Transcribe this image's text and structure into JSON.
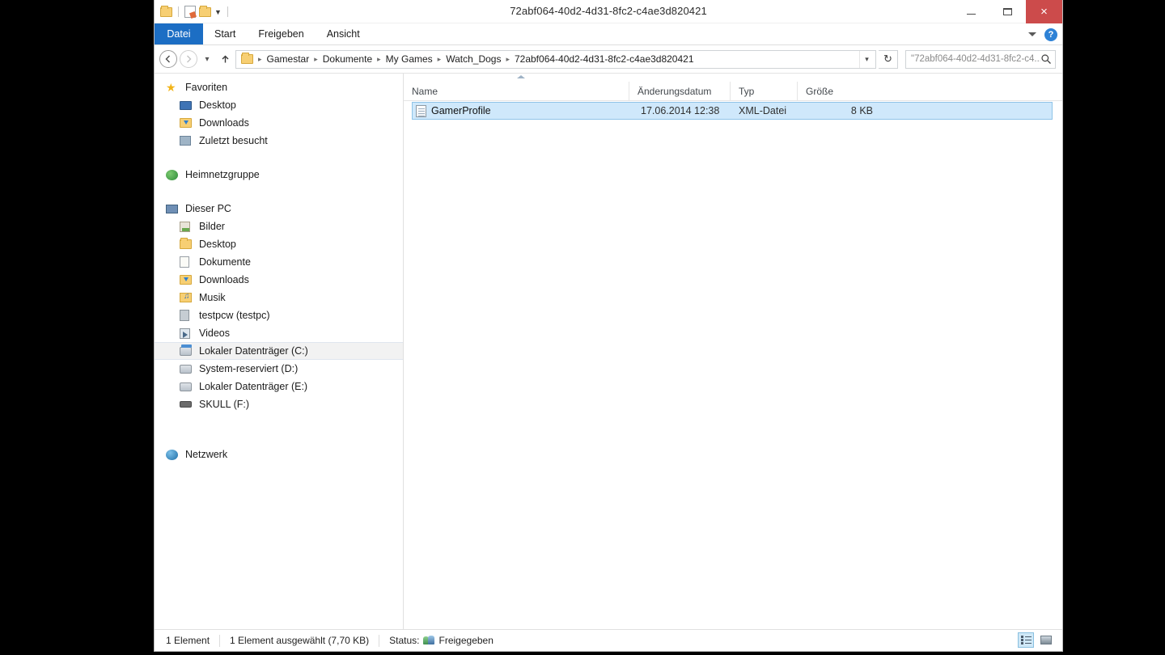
{
  "window": {
    "title": "72abf064-40d2-4d31-8fc2-c4ae3d820421",
    "minimize_label": "Minimieren",
    "maximize_label": "Maximieren",
    "close_label": "Schließen",
    "close_glyph": "×",
    "accent_close": "#cc4b4b",
    "accent_tab": "#1c6ec4"
  },
  "quick_access": {
    "items": [
      {
        "name": "folder-icon",
        "label": "Explorer"
      },
      {
        "name": "properties-icon",
        "label": "Eigenschaften"
      },
      {
        "name": "new-folder-icon",
        "label": "Neuer Ordner"
      },
      {
        "name": "chevron-down-icon",
        "label": "Symbolleiste anpassen"
      }
    ]
  },
  "ribbon": {
    "tabs": [
      {
        "label": "Datei",
        "active": true
      },
      {
        "label": "Start",
        "active": false
      },
      {
        "label": "Freigeben",
        "active": false
      },
      {
        "label": "Ansicht",
        "active": false
      }
    ],
    "expand_label": "Menüband erweitern",
    "help_label": "?"
  },
  "navigation": {
    "back_glyph": "←",
    "forward_glyph": "→",
    "recent_glyph": "▾",
    "up_glyph": "↑",
    "breadcrumbs": [
      "Gamestar",
      "Dokumente",
      "My Games",
      "Watch_Dogs",
      "72abf064-40d2-4d31-8fc2-c4ae3d820421"
    ],
    "crumb_separator": "▸",
    "dropdown_glyph": "▾",
    "refresh_glyph": "↻"
  },
  "search": {
    "value": "\"72abf064-40d2-4d31-8fc2-c4...",
    "placeholder": "\"72abf064-40d2-4d31-8fc2-c4..."
  },
  "sidebar": {
    "groups": [
      {
        "header": {
          "label": "Favoriten",
          "icon": "star-icon"
        },
        "items": [
          {
            "label": "Desktop",
            "icon": "monitor-icon"
          },
          {
            "label": "Downloads",
            "icon": "downloads-folder-icon"
          },
          {
            "label": "Zuletzt besucht",
            "icon": "recent-places-icon"
          }
        ]
      },
      {
        "header": {
          "label": "Heimnetzgruppe",
          "icon": "homegroup-icon"
        },
        "items": []
      },
      {
        "header": {
          "label": "Dieser PC",
          "icon": "this-pc-icon"
        },
        "items": [
          {
            "label": "Bilder",
            "icon": "pictures-icon"
          },
          {
            "label": "Desktop",
            "icon": "desktop-folder-icon"
          },
          {
            "label": "Dokumente",
            "icon": "documents-icon"
          },
          {
            "label": "Downloads",
            "icon": "downloads-folder-icon"
          },
          {
            "label": "Musik",
            "icon": "music-icon"
          },
          {
            "label": "testpcw (testpc)",
            "icon": "user-folder-icon"
          },
          {
            "label": "Videos",
            "icon": "videos-icon"
          },
          {
            "label": "Lokaler Datenträger (C:)",
            "icon": "hdd-system-icon",
            "selected": true
          },
          {
            "label": "System-reserviert (D:)",
            "icon": "hdd-icon"
          },
          {
            "label": "Lokaler Datenträger (E:)",
            "icon": "hdd-icon"
          },
          {
            "label": "SKULL (F:)",
            "icon": "usb-drive-icon"
          }
        ]
      },
      {
        "header": {
          "label": "Netzwerk",
          "icon": "network-icon"
        },
        "items": []
      }
    ]
  },
  "file_list": {
    "columns": [
      {
        "label": "Name",
        "sorted": "asc"
      },
      {
        "label": "Änderungsdatum"
      },
      {
        "label": "Typ"
      },
      {
        "label": "Größe"
      }
    ],
    "rows": [
      {
        "name": "GamerProfile",
        "modified": "17.06.2014 12:38",
        "type": "XML-Datei",
        "size": "8 KB",
        "icon": "xml-file-icon",
        "selected": true
      }
    ]
  },
  "status_bar": {
    "count": "1 Element",
    "selection": "1 Element ausgewählt (7,70 KB)",
    "status_label": "Status:",
    "status_value": "Freigegeben",
    "views": [
      {
        "name": "details-view-button",
        "active": true
      },
      {
        "name": "large-icons-view-button",
        "active": false
      }
    ]
  }
}
